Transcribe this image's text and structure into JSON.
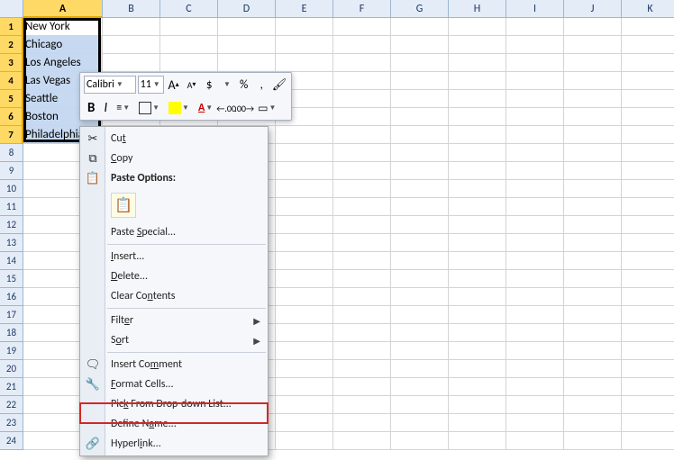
{
  "columns": [
    "A",
    "B",
    "C",
    "D",
    "E",
    "F",
    "G",
    "H",
    "I",
    "J",
    "K"
  ],
  "rows_count": 24,
  "selected_column": "A",
  "selected_rows": [
    1,
    2,
    3,
    4,
    5,
    6,
    7
  ],
  "data": {
    "A": [
      "New York",
      "Chicago",
      "Los Angeles",
      "Las Vegas",
      "Seattle",
      "Boston",
      "Philadelphia"
    ]
  },
  "minitoolbar": {
    "font": "Calibri",
    "size": "11",
    "grow_font": "A",
    "shrink_font": "A",
    "currency": "$",
    "percent": "%",
    "comma": ",",
    "bold": "B",
    "italic": "I",
    "font_color_letter": "A",
    "increase_decimal": ".00",
    "decrease_decimal": ".00"
  },
  "context_menu": {
    "cut": "Cut",
    "copy": "Copy",
    "paste_options": "Paste Options:",
    "paste_special": "Paste Special...",
    "insert": "Insert...",
    "delete": "Delete...",
    "clear": "Clear Contents",
    "filter": "Filter",
    "sort": "Sort",
    "insert_comment": "Insert Comment",
    "format_cells": "Format Cells...",
    "pick_list": "Pick From Drop-down List...",
    "define_name": "Define Name...",
    "hyperlink": "Hyperlink..."
  }
}
